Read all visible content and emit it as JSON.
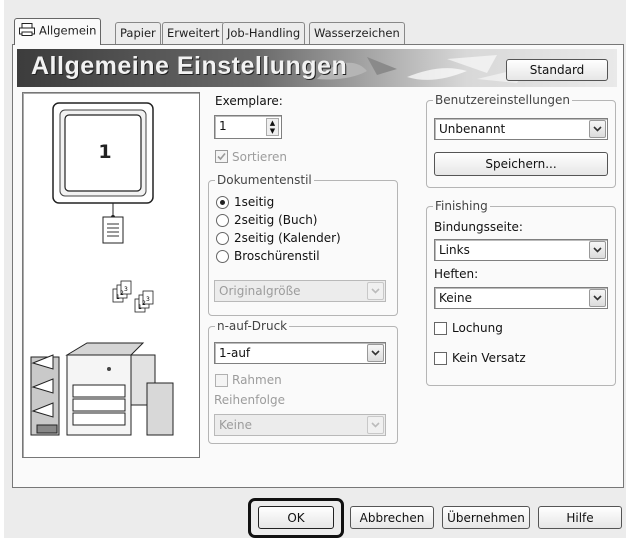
{
  "tabs": [
    {
      "label": "Allgemein",
      "active": true
    },
    {
      "label": "Papier"
    },
    {
      "label": "Erweitert"
    },
    {
      "label": "Job-Handling"
    },
    {
      "label": "Wasserzeichen"
    }
  ],
  "header": {
    "title": "Allgemeine Einstellungen",
    "standard_button": "Standard"
  },
  "preview": {
    "page_number": "1"
  },
  "copies": {
    "label": "Exemplare:",
    "value": "1",
    "sort_label": "Sortieren",
    "sort_checked": true
  },
  "document_style": {
    "title": "Dokumentenstil",
    "options": [
      "1seitig",
      "2seitig (Buch)",
      "2seitig (Kalender)",
      "Broschürenstil"
    ],
    "selected": "1seitig",
    "size_value": "Originalgröße"
  },
  "n_up": {
    "title": "n-auf-Druck",
    "value": "1-auf",
    "frame_label": "Rahmen",
    "order_label": "Reihenfolge",
    "order_value": "Keine"
  },
  "user_settings": {
    "title": "Benutzereinstellungen",
    "value": "Unbenannt",
    "save_button": "Speichern..."
  },
  "finishing": {
    "title": "Finishing",
    "binding_label": "Bindungsseite:",
    "binding_value": "Links",
    "staple_label": "Heften:",
    "staple_value": "Keine",
    "punch_label": "Lochung",
    "offset_label": "Kein Versatz"
  },
  "footer": {
    "ok": "OK",
    "cancel": "Abbrechen",
    "apply": "Übernehmen",
    "help": "Hilfe"
  },
  "colors": {
    "highlight_border": "#111111",
    "banner_dark": "#3c3c3c",
    "dialog_bg": "#ececec"
  }
}
